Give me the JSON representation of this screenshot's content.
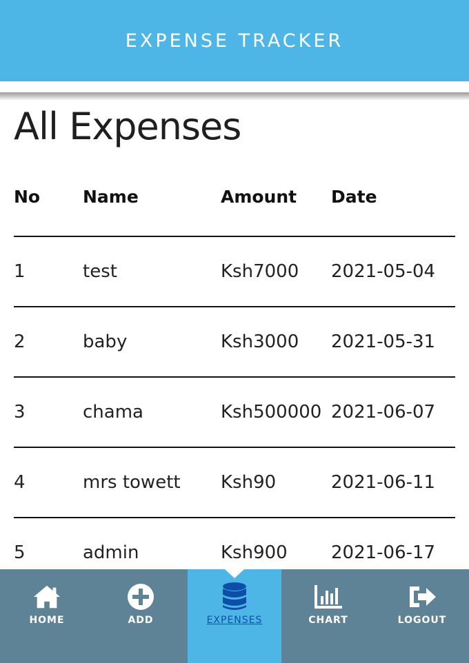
{
  "header": {
    "title": "EXPENSE TRACKER"
  },
  "page": {
    "title": "All Expenses"
  },
  "table": {
    "columns": [
      "No",
      "Name",
      "Amount",
      "Date"
    ],
    "rows": [
      {
        "no": "1",
        "name": "test",
        "amount": "Ksh7000",
        "date": "2021-05-04"
      },
      {
        "no": "2",
        "name": "baby",
        "amount": "Ksh3000",
        "date": "2021-05-31"
      },
      {
        "no": "3",
        "name": "chama",
        "amount": "Ksh500000",
        "date": "2021-06-07"
      },
      {
        "no": "4",
        "name": "mrs towett",
        "amount": "Ksh90",
        "date": "2021-06-11"
      },
      {
        "no": "5",
        "name": "admin",
        "amount": "Ksh900",
        "date": "2021-06-17"
      }
    ]
  },
  "nav": {
    "items": [
      {
        "label": "HOME",
        "icon": "home-icon"
      },
      {
        "label": "ADD",
        "icon": "plus-circle-icon"
      },
      {
        "label": "EXPENSES",
        "icon": "database-icon",
        "active": true
      },
      {
        "label": "CHART",
        "icon": "bar-chart-icon"
      },
      {
        "label": "LOGOUT",
        "icon": "logout-icon"
      }
    ]
  },
  "colors": {
    "header": "#4db6e6",
    "nav": "#5f8396",
    "active_nav": "#4db6e6",
    "active_label": "#0d4fa8"
  }
}
